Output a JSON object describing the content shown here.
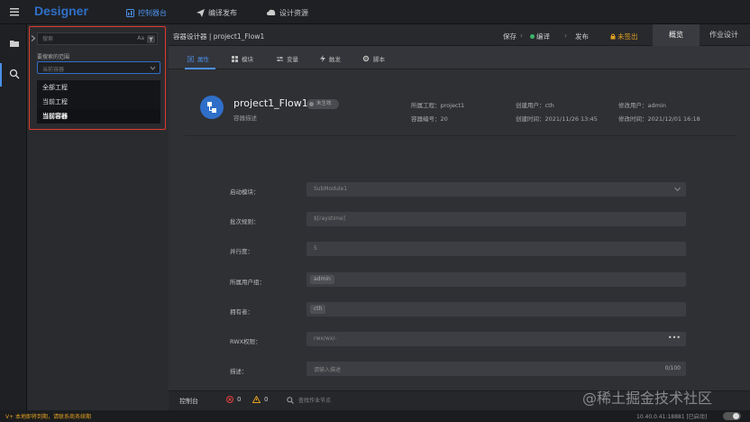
{
  "app": {
    "logo": "Designer"
  },
  "nav": [
    {
      "label": "控制器台",
      "icon": "dashboard-icon"
    },
    {
      "label": "编译发布",
      "icon": "send-icon"
    },
    {
      "label": "设计资源",
      "icon": "cloud-icon"
    }
  ],
  "search": {
    "placeholder": "搜索",
    "case_label": "Aa",
    "scope_label": "要搜索的范围",
    "scope_selected": "当前容器",
    "options": [
      "全部工程",
      "当前工程",
      "当前容器"
    ]
  },
  "toolbar": {
    "breadcrumb": "容器设计器 | project1_Flow1",
    "save": "保存",
    "compile": "编译",
    "publish": "发布",
    "checkout": "未签出",
    "tab_overview": "概览",
    "tab_jobs": "作业设计"
  },
  "subtabs": [
    "属性",
    "模块",
    "变量",
    "触发",
    "脚本"
  ],
  "info": {
    "title": "project1_Flow1",
    "status": "未生效",
    "desc": "容器描述",
    "project_label": "所属工程：",
    "project": "project1",
    "number_label": "容器编号：",
    "number": "20",
    "creator_label": "创建用户：",
    "creator": "cth",
    "created_label": "创建时间：",
    "created": "2021/11/26 13:45",
    "modifier_label": "修改用户：",
    "modifier": "admin",
    "modified_label": "修改时间：",
    "modified": "2021/12/01 16:18"
  },
  "form": {
    "start_module_label": "启动模块：",
    "start_module": "SubModule1",
    "batch_label": "批次规则：",
    "batch": "$[raystime]",
    "parallel_label": "并行度：",
    "parallel": "5",
    "group_label": "所属用户组：",
    "group": "admin",
    "owner_label": "拥有者：",
    "owner": "cth",
    "rwx_label": "RWX权限：",
    "rwx": "rwx/wx/-",
    "desc_label": "描述：",
    "desc_placeholder": "请输入描述",
    "desc_count": "0/100"
  },
  "bottom": {
    "console": "控制台",
    "errors": "0",
    "warnings": "0",
    "search_hint": "查找作业节点"
  },
  "statusbar": {
    "license": "V+ 本地即将到期，请联系商务续期",
    "host": "10.40.0.41:18881 [已启动]"
  },
  "watermark": "@稀土掘金技术社区",
  "colors": {
    "accent": "#2f6fc9",
    "highlight": "#e23b2a",
    "warning": "#e0a020",
    "error": "#e04040"
  }
}
